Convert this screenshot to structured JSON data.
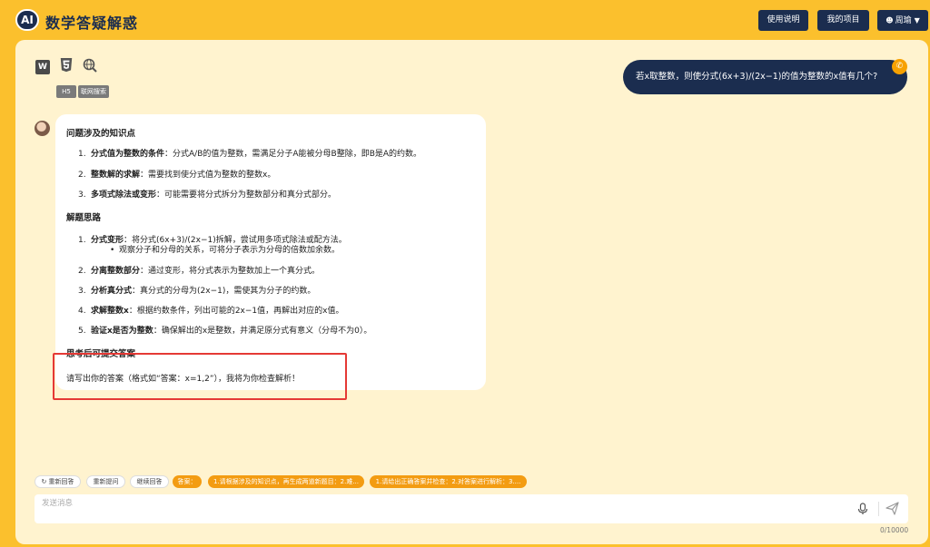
{
  "header": {
    "logo": "AI",
    "title": "数学答疑解惑",
    "buttons": {
      "usage": "使用说明",
      "projects": "我的项目",
      "user": "周瑜"
    }
  },
  "tools": {
    "word_icon": "W",
    "h5_label": "H5",
    "web_label": "联网搜索"
  },
  "user_message": "若x取整数，则使分式(6x+3)/(2x−1)的值为整数的x值有几个?",
  "answer": {
    "section1": {
      "title": "问题涉及的知识点",
      "items": [
        {
          "num": "1.",
          "bold": "分式值为整数的条件",
          "text": "：分式A/B的值为整数，需满足分子A能被分母B整除，即B是A的约数。"
        },
        {
          "num": "2.",
          "bold": "整数解的求解",
          "text": "：需要找到使分式值为整数的整数x。"
        },
        {
          "num": "3.",
          "bold": "多项式除法或变形",
          "text": "：可能需要将分式拆分为整数部分和真分式部分。"
        }
      ]
    },
    "section2": {
      "title": "解题思路",
      "items": [
        {
          "num": "1.",
          "bold": "分式变形",
          "text": "：将分式(6x+3)/(2x−1)拆解，尝试用多项式除法或配方法。"
        },
        {
          "num": "2.",
          "bold": "分离整数部分",
          "text": "：通过变形，将分式表示为整数加上一个真分式。"
        },
        {
          "num": "3.",
          "bold": "分析真分式",
          "text": "：真分式的分母为(2x−1)，需使其为分子的约数。"
        },
        {
          "num": "4.",
          "bold": "求解整数x",
          "text": "：根据约数条件，列出可能的2x−1值，再解出对应的x值。"
        },
        {
          "num": "5.",
          "bold": "验证x是否为整数",
          "text": "：确保解出的x是整数，并满足原分式有意义（分母不为0）。"
        }
      ],
      "sub_item": "观察分子和分母的关系，可将分子表示为分母的倍数加余数。"
    },
    "section3": {
      "title": "思考后可提交答案"
    },
    "prompt": "请写出你的答案（格式如“答案：x=1,2”），我将为你检查解析！"
  },
  "chips": {
    "regenerate": "重新回答",
    "reask": "重新提问",
    "continue": "继续回答",
    "answer": "答案：",
    "q1": "1.请根据涉及的知识点，再生成两道新题目：2.难...",
    "q2": "1.请给出正确答案并检查：2.对答案进行解析：3...."
  },
  "input": {
    "placeholder": "发送消息",
    "counter": "0/10000"
  },
  "colors": {
    "brand": "#fbc02d",
    "navy": "#1b2d4f",
    "panel": "#fff3cf",
    "chip_orange": "#f39c12",
    "highlight": "#e53935"
  }
}
